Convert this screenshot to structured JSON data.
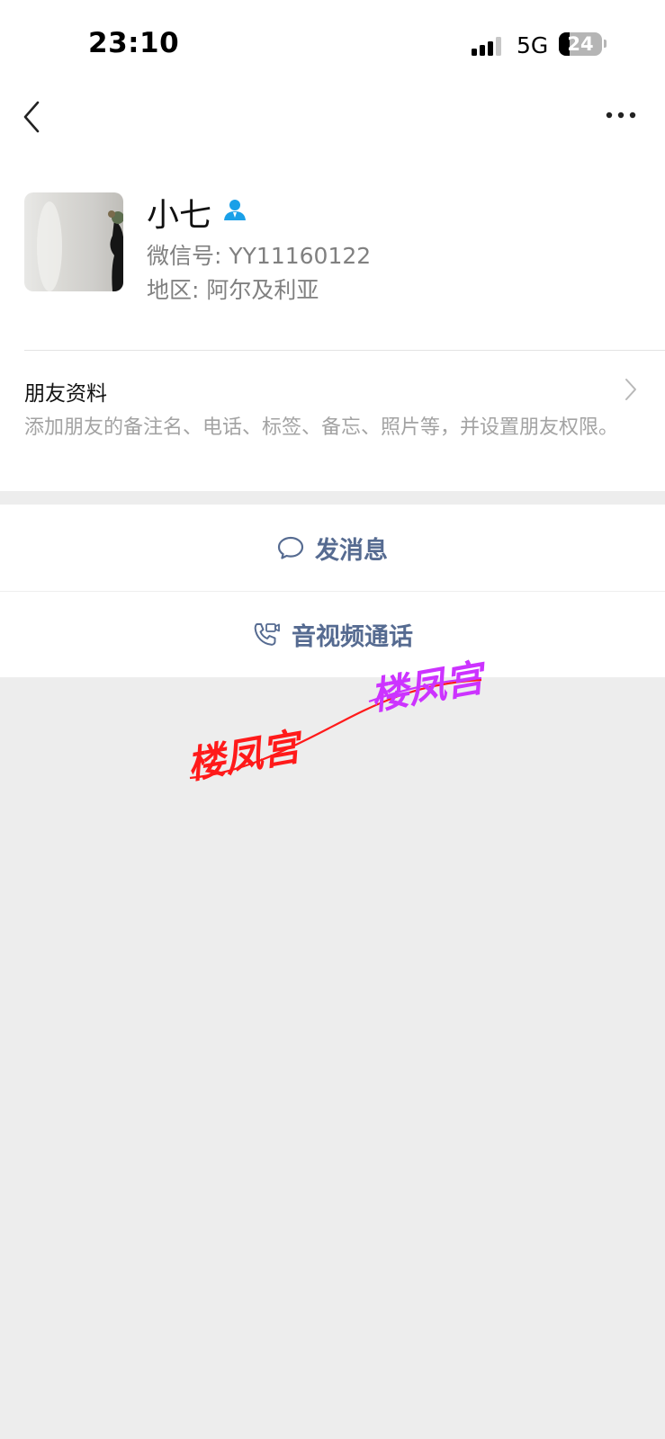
{
  "status_bar": {
    "time": "23:10",
    "network": "5G",
    "battery": "24"
  },
  "nav": {
    "back_icon": "chevron-left-icon",
    "more_icon": "more-dots-icon"
  },
  "profile": {
    "name": "小七",
    "gender_icon": "male-user-icon",
    "wechat_id": "微信号: YY11160122",
    "region": "地区: 阿尔及利亚"
  },
  "friend_info": {
    "title": "朋友资料",
    "description": "添加朋友的备注名、电话、标签、备忘、照片等，并设置朋友权限。"
  },
  "actions": {
    "message_label": "发消息",
    "call_label": "音视频通话"
  },
  "stamp_texts": [
    "楼凤宫",
    "楼凤宫"
  ],
  "colors": {
    "action_text": "#566b91",
    "gender_icon": "#1aa0e8",
    "stamp_red": "#ff1a1a",
    "stamp_purple": "#cc33ff"
  }
}
